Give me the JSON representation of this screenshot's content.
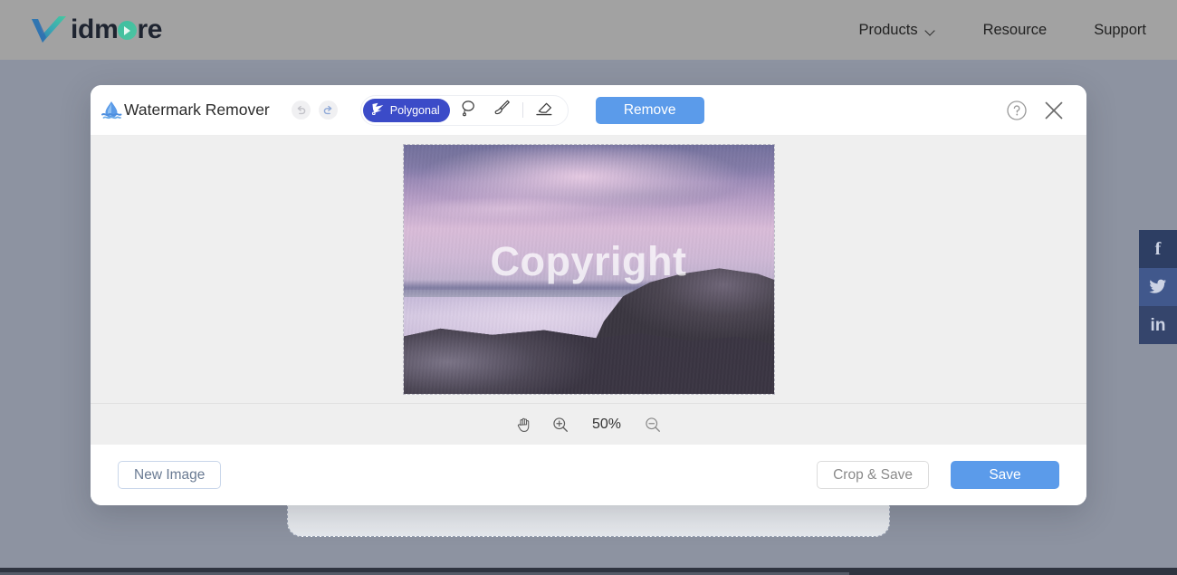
{
  "site": {
    "brand": {
      "prefix": "id",
      "mid": "m",
      "o_icon": "play-circle-icon",
      "suffix": "re",
      "logo_icon": "checkmark-v-logo-icon"
    },
    "nav": [
      {
        "label": "Products",
        "has_dropdown": true,
        "icon": "chevron-down-icon"
      },
      {
        "label": "Resource",
        "has_dropdown": false
      },
      {
        "label": "Support",
        "has_dropdown": false
      }
    ],
    "header_bg": "#a2a2a2",
    "body_bg": "#8d93a1"
  },
  "modal": {
    "app_logo_icon": "water-drop-icon",
    "title": "Watermark Remover",
    "history": {
      "undo": {
        "icon": "undo-arrow-icon",
        "enabled": false
      },
      "redo": {
        "icon": "redo-arrow-icon",
        "enabled": true
      }
    },
    "tools": {
      "active": "Polygonal",
      "polygonal": {
        "label": "Polygonal",
        "icon": "polygonal-lasso-icon",
        "active_color": "#3b4bc8"
      },
      "lasso": {
        "icon": "lasso-icon",
        "label": "Lasso"
      },
      "brush": {
        "icon": "brush-icon",
        "label": "Brush"
      },
      "eraser": {
        "icon": "eraser-icon",
        "label": "Eraser"
      }
    },
    "remove_label": "Remove",
    "remove_color": "#5b9bea",
    "help_icon": "question-circle-icon",
    "close_icon": "close-x-icon",
    "canvas": {
      "watermark_text": "Copyright",
      "image_alt": "coastal-dusk-landscape",
      "frame_width": "409",
      "frame_height": "275"
    },
    "zoom": {
      "hand_icon": "hand-pan-icon",
      "zoom_in_icon": "zoom-in-icon",
      "zoom_out_icon": "zoom-out-icon",
      "level": "50%"
    },
    "footer": {
      "new_image_label": "New Image",
      "crop_save_label": "Crop & Save",
      "save_label": "Save",
      "save_color": "#5b9bea"
    }
  },
  "social": [
    {
      "name": "facebook",
      "glyph": "f",
      "icon": "facebook-icon",
      "color": "#2d3e63"
    },
    {
      "name": "twitter",
      "glyph": "🐦",
      "icon": "twitter-icon",
      "color": "#41588c"
    },
    {
      "name": "linkedin",
      "glyph": "in",
      "icon": "linkedin-icon",
      "color": "#35456c"
    }
  ]
}
